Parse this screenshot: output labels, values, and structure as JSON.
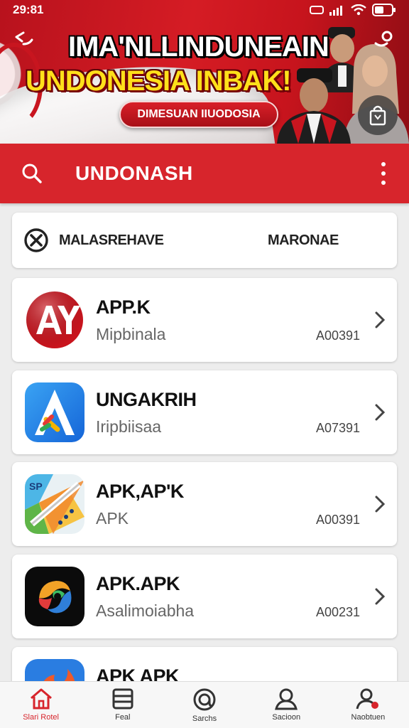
{
  "status_bar": {
    "time": "29:81"
  },
  "banner": {
    "headline_1": "IMA'NLLINDUNEAIN",
    "headline_2": "UNDONESIA INBAK!",
    "pill_label": "DIMESUAN IIUODOSIA"
  },
  "search": {
    "text": "UNDONASH"
  },
  "filter": {
    "label": "MALASREHAVE",
    "value": "MARONAE"
  },
  "apps": [
    {
      "title": "APP.K",
      "subtitle": "Mipbinala",
      "code": "A00391",
      "icon": "ay-logo-icon"
    },
    {
      "title": "UNGAKRIH",
      "subtitle": "Iripbiisaa",
      "code": "A07391",
      "icon": "a-triangle-logo-icon"
    },
    {
      "title": "APK,AP'K",
      "subtitle": "APK",
      "code": "A00391",
      "icon": "map-logo-icon"
    },
    {
      "title": "APK.APK",
      "subtitle": "Asalimoiabha",
      "code": "A00231",
      "icon": "color-swirl-logo-icon"
    },
    {
      "title": "APK APK",
      "subtitle": "",
      "code": "",
      "icon": "fire-logo-icon"
    }
  ],
  "nav": [
    {
      "label": "Slari Rotel",
      "icon": "home-icon",
      "active": true
    },
    {
      "label": "Feal",
      "icon": "stack-icon",
      "active": false
    },
    {
      "label": "Sarchs",
      "icon": "at-search-icon",
      "active": false
    },
    {
      "label": "Sacioon",
      "icon": "profile-icon",
      "active": false
    },
    {
      "label": "Naobtuen",
      "icon": "notification-user-icon",
      "active": false
    }
  ],
  "colors": {
    "brand_red": "#d7252c",
    "banner_yellow": "#ffe01a"
  }
}
